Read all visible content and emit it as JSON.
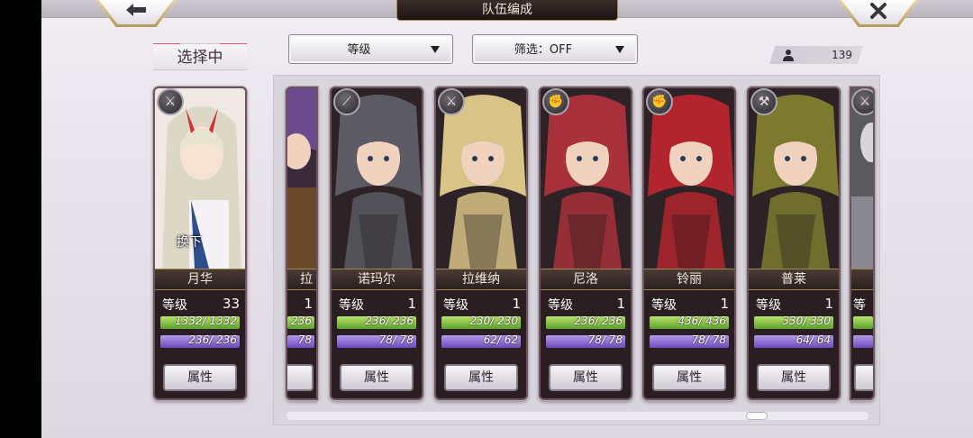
{
  "header": {
    "title": "队伍编成",
    "back_icon": "left-arrow-icon",
    "close_icon": "close-x-icon"
  },
  "selected_label": "选择中",
  "sort_dropdown": {
    "value": "等级"
  },
  "filter_dropdown": {
    "value": "筛选：OFF"
  },
  "unit_count": "139",
  "remove_label": "换下",
  "level_label": "等级",
  "attr_label": "属性",
  "selected_unit": {
    "name": "月华",
    "level": "33",
    "hp": "1332/ 1332",
    "mp": "236/ 236",
    "hp_pct": 100,
    "mp_pct": 100,
    "class_icon": "sword-icon",
    "palette": "#e9e6df"
  },
  "units": [
    {
      "name": "拉",
      "level": "1",
      "hp": "236",
      "mp": "78",
      "hp_pct": 100,
      "mp_pct": 100,
      "palette": "#6b4a8e"
    },
    {
      "name": "诺玛尔",
      "level": "1",
      "hp": "236/ 236",
      "mp": "78/ 78",
      "hp_pct": 100,
      "mp_pct": 100,
      "class_icon": "spear-icon",
      "palette": "#5c5a63"
    },
    {
      "name": "拉维纳",
      "level": "1",
      "hp": "230/ 230",
      "mp": "62/ 62",
      "hp_pct": 100,
      "mp_pct": 100,
      "class_icon": "sword-icon",
      "palette": "#d9c487"
    },
    {
      "name": "尼洛",
      "level": "1",
      "hp": "236/ 236",
      "mp": "78/ 78",
      "hp_pct": 100,
      "mp_pct": 100,
      "class_icon": "fist-icon",
      "palette": "#a8303a"
    },
    {
      "name": "铃丽",
      "level": "1",
      "hp": "436/ 436",
      "mp": "78/ 78",
      "hp_pct": 100,
      "mp_pct": 100,
      "class_icon": "fist-icon",
      "palette": "#b3252e"
    },
    {
      "name": "普莱",
      "level": "1",
      "hp": "330/ 330",
      "mp": "64/ 64",
      "hp_pct": 100,
      "mp_pct": 100,
      "class_icon": "hammer-icon",
      "palette": "#7d7a2f"
    }
  ]
}
